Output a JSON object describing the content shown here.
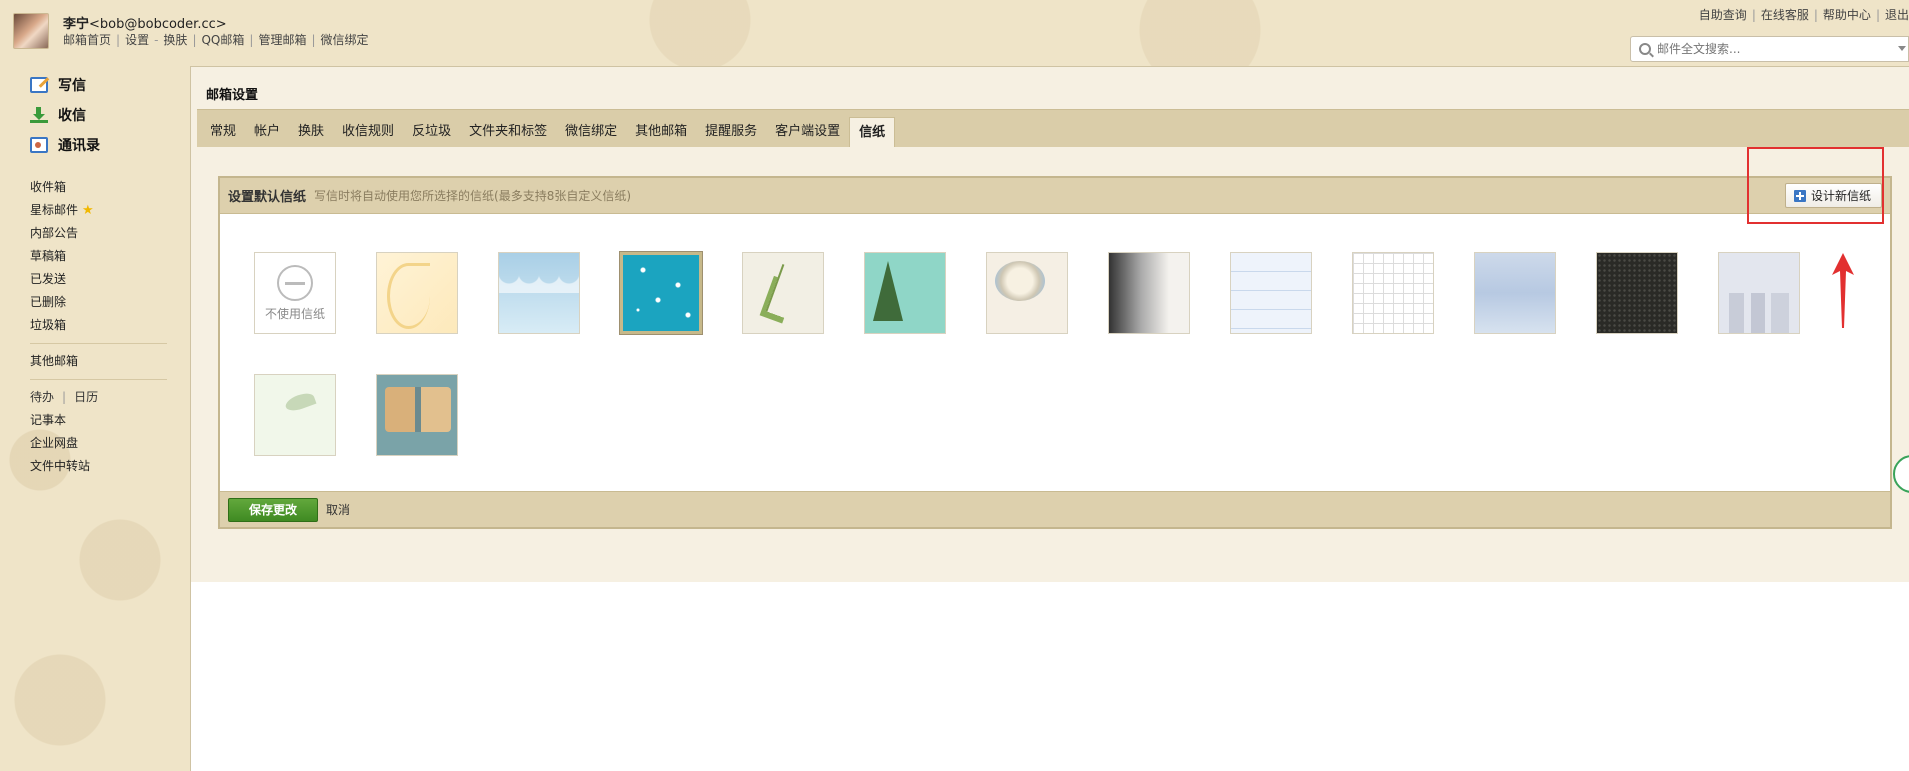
{
  "header": {
    "user_name": "李宁",
    "user_email": "<bob@bobcoder.cc>",
    "links": [
      "邮箱首页",
      "设置",
      "换肤",
      "QQ邮箱",
      "管理邮箱",
      "微信绑定"
    ],
    "link_dash": "-",
    "top_right": [
      "自助查询",
      "在线客服",
      "帮助中心",
      "退出"
    ],
    "search_placeholder": "邮件全文搜索..."
  },
  "sidebar": {
    "compose": "写信",
    "inbox": "收信",
    "contacts": "通讯录",
    "folders": [
      "收件箱",
      "星标邮件",
      "内部公告",
      "草稿箱",
      "已发送",
      "已删除",
      "垃圾箱"
    ],
    "other_mail": "其他邮箱",
    "todo": "待办",
    "calendar": "日历",
    "notes": "记事本",
    "netdisk": "企业网盘",
    "transfer": "文件中转站"
  },
  "main": {
    "page_title": "邮箱设置",
    "tabs": [
      {
        "label": "常规"
      },
      {
        "label": "帐户"
      },
      {
        "label": "换肤"
      },
      {
        "label": "收信规则"
      },
      {
        "label": "反垃圾"
      },
      {
        "label": "文件夹和标签"
      },
      {
        "label": "微信绑定"
      },
      {
        "label": "其他邮箱"
      },
      {
        "label": "提醒服务"
      },
      {
        "label": "客户端设置"
      },
      {
        "label": "信纸",
        "active": true
      }
    ],
    "box": {
      "title": "设置默认信纸",
      "description": "写信时将自动使用您所选择的信纸(最多支持8张自定义信纸)",
      "design_button": "设计新信纸",
      "none_label": "不使用信纸",
      "thumbnails": [
        "none",
        "swirl",
        "clouds",
        "snow",
        "leaves",
        "tree",
        "dumplings",
        "smoke",
        "lines",
        "grid",
        "hills",
        "dark",
        "city",
        "bird",
        "train"
      ],
      "selected": "snow",
      "save_button": "保存更改",
      "cancel": "取消"
    }
  }
}
